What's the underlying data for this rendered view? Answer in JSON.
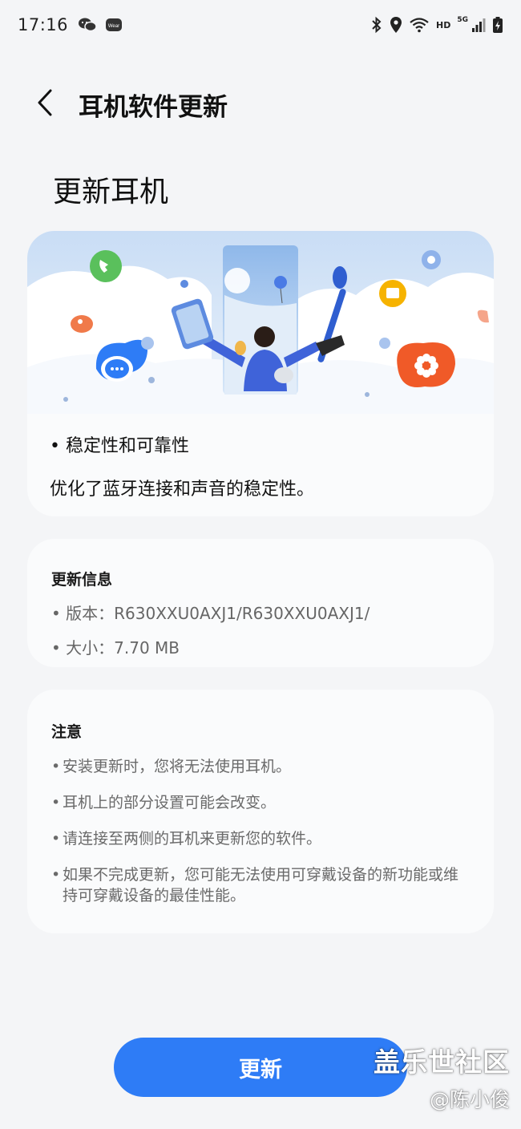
{
  "status_bar": {
    "time": "17:16",
    "left_icons": [
      "wechat-icon",
      "wear-icon"
    ],
    "wear_label": "Wear",
    "right_icons": [
      "bluetooth-icon",
      "location-icon",
      "wifi-icon",
      "signal-icon",
      "battery-icon"
    ],
    "hd_label": "HD",
    "network_label": "5G"
  },
  "header": {
    "back_icon": "chevron-left-icon",
    "title": "耳机软件更新"
  },
  "page": {
    "heading": "更新耳机"
  },
  "hero_card": {
    "bullet_title": "• 稳定性和可靠性",
    "description": "优化了蓝牙连接和声音的稳定性。"
  },
  "info_card": {
    "title": "更新信息",
    "version": "• 版本：R630XXU0AXJ1/R630XXU0AXJ1/",
    "size": "• 大小：7.70 MB"
  },
  "note_card": {
    "title": "注意",
    "items": [
      "安装更新时，您将无法使用耳机。",
      "耳机上的部分设置可能会改变。",
      "请连接至两侧的耳机来更新您的软件。",
      "如果不完成更新，您可能无法使用可穿戴设备的新功能或维持可穿戴设备的最佳性能。"
    ]
  },
  "actions": {
    "update_label": "更新"
  },
  "watermark": {
    "main": "盖乐世社区",
    "sub": "@陈小俊"
  },
  "colors": {
    "accent": "#2e7cf6",
    "background": "#f4f5f7",
    "card": "#fafbfc"
  }
}
